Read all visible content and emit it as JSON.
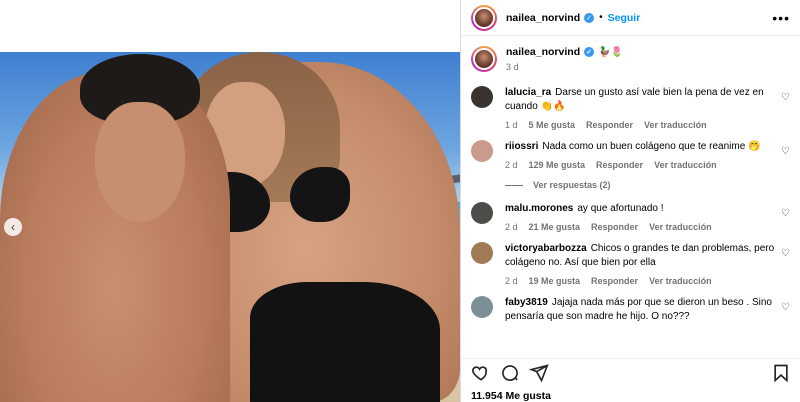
{
  "header": {
    "username": "nailea_norvind",
    "separator": "•",
    "follow_label": "Seguir",
    "more_label": "•••"
  },
  "caption": {
    "username": "nailea_norvind",
    "emoji": "🦆🌷",
    "time": "3 d"
  },
  "comments": [
    {
      "user": "lalucia_ra",
      "text": "Darse un gusto así vale bien la pena de vez en cuando 👏🔥",
      "time": "1 d",
      "likes": "5 Me gusta",
      "reply": "Responder",
      "translate": "Ver traducción",
      "avatar_color": "#3a3330"
    },
    {
      "user": "riiossri",
      "text": "Nada como un buen colágeno que te reanime 🤭",
      "time": "2 d",
      "likes": "129 Me gusta",
      "reply": "Responder",
      "translate": "Ver traducción",
      "avatar_color": "#c99b8a"
    },
    {
      "user": "malu.morones",
      "text": "ay que afortunado !",
      "time": "2 d",
      "likes": "21 Me gusta",
      "reply": "Responder",
      "translate": "Ver traducción",
      "avatar_color": "#4a4d48"
    },
    {
      "user": "victoryabarbozza",
      "text": "Chicos o grandes te dan problemas, pero colágeno no. Así que bien por ella",
      "time": "2 d",
      "likes": "19 Me gusta",
      "reply": "Responder",
      "translate": "Ver traducción",
      "avatar_color": "#a07a55"
    },
    {
      "user": "faby3819",
      "text": "Jajaja nada más por que se dieron un beso . Sino pensaría que son madre he hijo. O no???",
      "time": "",
      "likes": "",
      "reply": "",
      "translate": "",
      "avatar_color": "#7d8f96"
    }
  ],
  "replies_label": "Ver respuestas (2)",
  "likes_count": "11.954 Me gusta",
  "icons": {
    "heart": "heart-icon",
    "comment": "comment-icon",
    "share": "share-icon",
    "save": "bookmark-icon",
    "prev": "chevron-left-icon"
  },
  "colors": {
    "accent": "#0095f6",
    "verified": "#3897f0",
    "muted": "#737373"
  }
}
